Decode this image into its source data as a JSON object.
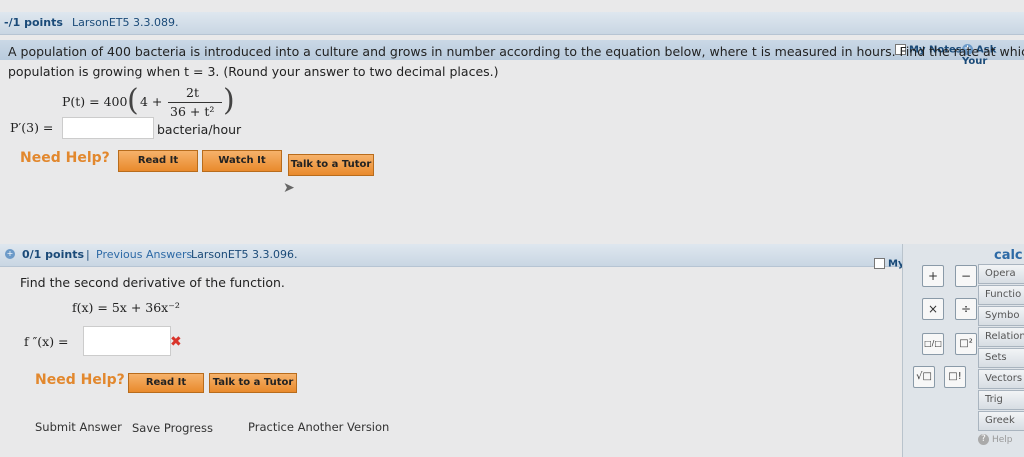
{
  "q1": {
    "points": "-/1 points",
    "source": "LarsonET5 3.3.089.",
    "my_notes": "My Notes",
    "ask": "Ask Your",
    "text_line1": "A population of 400 bacteria is introduced into a culture and grows in number according to the equation below, where t is measured in hours. Find the rate at which the",
    "text_line2": "population is growing when t = 3. (Round your answer to two decimal places.)",
    "eq_lhs": "P(t) = 400",
    "eq_four_plus": "4 +",
    "eq_num": "2t",
    "eq_den": "36 + t²",
    "answer_label": "P′(3) =",
    "answer_value": "",
    "unit": "bacteria/hour",
    "need_help": "Need Help?",
    "read_it": "Read It",
    "watch_it": "Watch It",
    "talk_tutor": "Talk to a Tutor"
  },
  "q2": {
    "points": "0/1 points",
    "sep": "|",
    "prev": "Previous Answers",
    "source": "LarsonET5 3.3.096.",
    "my_notes": "My No",
    "instruction": "Find the second derivative of the function.",
    "func": "f(x) = 5x + 36x⁻²",
    "answer_label": "f ″(x) =",
    "answer_value": "",
    "wrong_mark": "✖",
    "need_help": "Need Help?",
    "read_it": "Read It",
    "talk_tutor": "Talk to a Tutor"
  },
  "footer": {
    "submit": "Submit Answer",
    "save": "Save Progress",
    "practice": "Practice Another Version"
  },
  "calc": {
    "title": "calc",
    "keys": [
      "+",
      "−",
      "×",
      "÷",
      "□/□",
      "□²",
      "√□",
      "□!"
    ],
    "tabs": [
      "Opera",
      "Functio",
      "Symbo",
      "Relation",
      "Sets",
      "Vectors",
      "Trig",
      "Greek"
    ],
    "help": "Help"
  },
  "colors": {
    "accent": "#e98a2c",
    "header": "#c9d6e3",
    "error": "#d9342b"
  }
}
